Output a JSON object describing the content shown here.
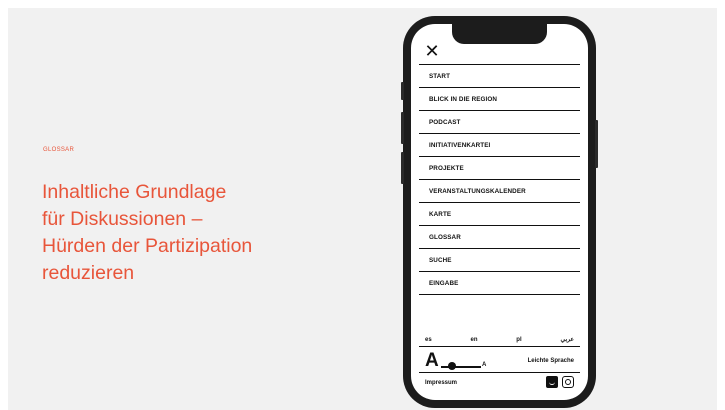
{
  "section_label": "GLOSSAR",
  "headline": "Inhaltliche Grundlage\nfür Diskussionen –\nHürden der Partizipation\nreduzieren",
  "colors": {
    "accent": "#e8553a",
    "background": "#f1f1f1",
    "phone_frame": "#1c1c1c"
  },
  "phone": {
    "close_icon": "close-icon",
    "menu": [
      "START",
      "BLICK IN DIE REGION",
      "PODCAST",
      "INITIATIVENKARTEI",
      "PROJEKTE",
      "VERANSTALTUNGSKALENDER",
      "KARTE",
      "GLOSSAR",
      "SUCHE",
      "EINGABE"
    ],
    "languages": [
      "es",
      "en",
      "pl",
      "عربي"
    ],
    "font_size_large": "A",
    "font_size_small": "A",
    "easy_language": "Leichte Sprache",
    "impressum": "Impressum",
    "social_icons": [
      "twitter-icon",
      "instagram-icon"
    ]
  }
}
